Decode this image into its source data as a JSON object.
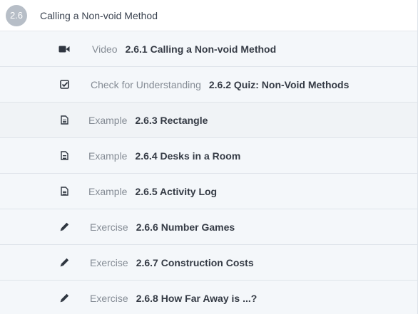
{
  "section": {
    "number": "2.6",
    "title": "Calling a Non-void Method"
  },
  "items": [
    {
      "type": "Video",
      "title": "2.6.1 Calling a Non-void Method",
      "icon": "video-camera-icon"
    },
    {
      "type": "Check for Understanding",
      "title": "2.6.2 Quiz: Non-Void Methods",
      "icon": "checkbox-icon"
    },
    {
      "type": "Example",
      "title": "2.6.3 Rectangle",
      "icon": "document-icon"
    },
    {
      "type": "Example",
      "title": "2.6.4 Desks in a Room",
      "icon": "document-icon"
    },
    {
      "type": "Example",
      "title": "2.6.5 Activity Log",
      "icon": "document-icon"
    },
    {
      "type": "Exercise",
      "title": "2.6.6 Number Games",
      "icon": "pencil-icon"
    },
    {
      "type": "Exercise",
      "title": "2.6.7 Construction Costs",
      "icon": "pencil-icon"
    },
    {
      "type": "Exercise",
      "title": "2.6.8 How Far Away is ...?",
      "icon": "pencil-icon"
    }
  ],
  "colors": {
    "badge_bg": "#b7bec7",
    "row_bg": "#f4f7fa",
    "type_text": "#858c95",
    "title_text": "#353b45"
  }
}
